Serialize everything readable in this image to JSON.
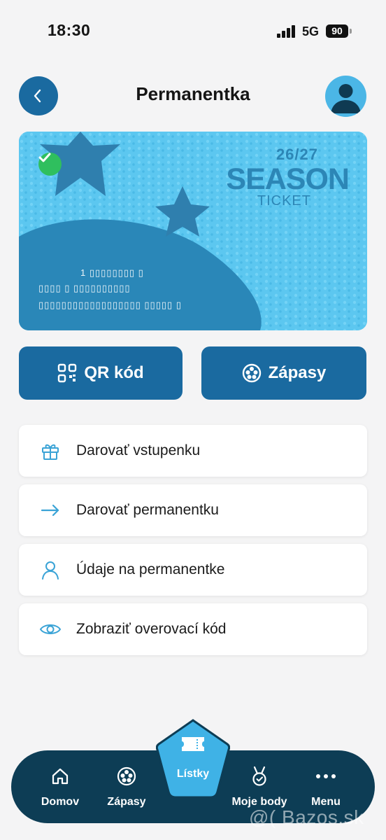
{
  "status_bar": {
    "time": "18:30",
    "network": "5G",
    "battery": "90"
  },
  "header": {
    "title": "Permanentka"
  },
  "ticket": {
    "season_year": "26/27",
    "season_word": "SEASON",
    "season_sub": "TICKET",
    "holder_line_1": "1 ▯▯▯▯▯▯▯▯ ▯",
    "holder_line_2": "▯▯▯▯ ▯ ▯▯▯▯▯▯▯▯▯▯",
    "holder_line_3": "▯▯▯▯▯▯▯▯▯▯▯▯▯▯▯▯▯▯ ▯▯▯▯▯ ▯",
    "colors": {
      "card": "#5cc7f0",
      "accent": "#2c86b6",
      "verified": "#2fbf5e"
    }
  },
  "actions": {
    "qr_label": "QR kód",
    "zapasy_label": "Zápasy"
  },
  "options": [
    {
      "label": "Darovať vstupenku",
      "icon": "gift-icon"
    },
    {
      "label": "Darovať permanentku",
      "icon": "arrow-right-icon"
    },
    {
      "label": "Údaje na permanentke",
      "icon": "user-icon"
    },
    {
      "label": "Zobraziť overovací kód",
      "icon": "eye-icon"
    }
  ],
  "nav": {
    "items": [
      {
        "label": "Domov",
        "icon": "home-icon"
      },
      {
        "label": "Zápasy",
        "icon": "football-icon"
      },
      {
        "label": "Lístky",
        "icon": "ticket-icon"
      },
      {
        "label": "Moje body",
        "icon": "medal-icon"
      },
      {
        "label": "Menu",
        "icon": "more-icon"
      }
    ]
  },
  "watermark": "@( Bazos.sk",
  "colors": {
    "primary": "#1a6aa0",
    "nav_bg": "#0d3d55",
    "center_tab": "#3fb2e6",
    "icon_accent": "#3aa3d6"
  }
}
